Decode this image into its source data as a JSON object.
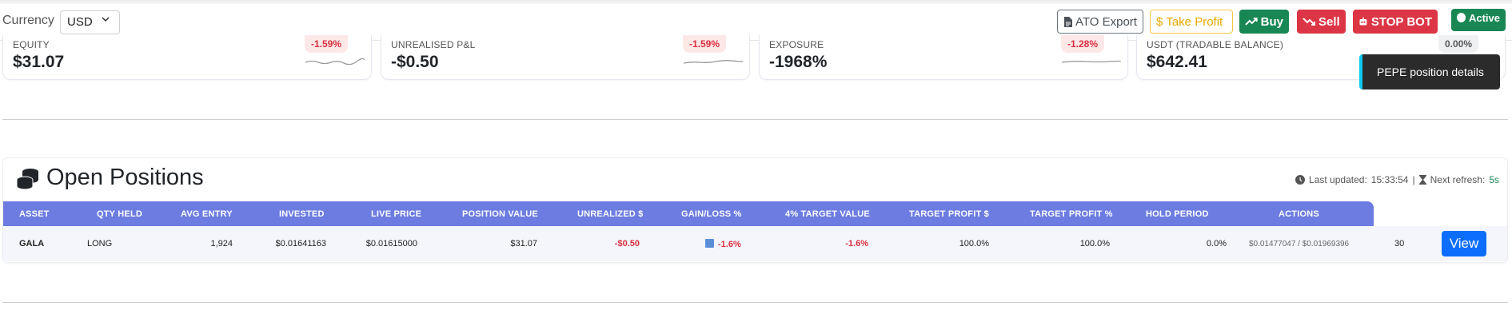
{
  "header": {
    "currency_label": "Currency",
    "currency_value": "USD",
    "buttons": {
      "export": "ATO Export",
      "take_profit": "Take Profit",
      "buy": "Buy",
      "sell": "Sell",
      "stop": "STOP BOT",
      "active": "Active"
    }
  },
  "cards": [
    {
      "label": "EQUITY",
      "value": "$31.07",
      "badge": "-1.59%"
    },
    {
      "label": "UNREALISED P&L",
      "value": "-$0.50",
      "badge": "-1.59%"
    },
    {
      "label": "EXPOSURE",
      "value": "-1968%",
      "badge": "-1.28%"
    },
    {
      "label": "USDT (TRADABLE BALANCE)",
      "value": "$642.41",
      "badge": "0.00%"
    }
  ],
  "tooltip": "PEPE position details",
  "positions": {
    "title": "Open Positions",
    "last_updated_label": "Last updated:",
    "last_updated": "15:33:54",
    "separator": "|",
    "next_refresh_label": "Next refresh:",
    "next_refresh": "5s",
    "columns": [
      "ASSET",
      "QTY HELD",
      "AVG ENTRY",
      "INVESTED",
      "LIVE PRICE",
      "POSITION VALUE",
      "UNREALIZED $",
      "GAIN/LOSS %",
      "4% TARGET VALUE",
      "TARGET PROFIT $",
      "TARGET PROFIT %",
      "HOLD PERIOD",
      "ACTIONS"
    ],
    "rows": [
      {
        "asset": "GALA",
        "side": "LONG",
        "qty": "1,924",
        "avg_entry": "$0.01641163",
        "invested": "$0.01615000",
        "live_price": "$31.07",
        "position_value": "-$0.50",
        "gain_loss": "-1.6%",
        "target_value": "-1.6%",
        "target_profit_usd": "100.0%",
        "target_profit_pct": "100.0%",
        "hold_period": "0.0%",
        "range": "$0.01477047 / $0.01969396",
        "count": "30",
        "action": "View"
      }
    ]
  },
  "colors": {
    "primary": "#0d6efd",
    "success": "#198754",
    "danger": "#dc3545",
    "warning": "#f5c542",
    "table_header": "#6c7ce0"
  }
}
